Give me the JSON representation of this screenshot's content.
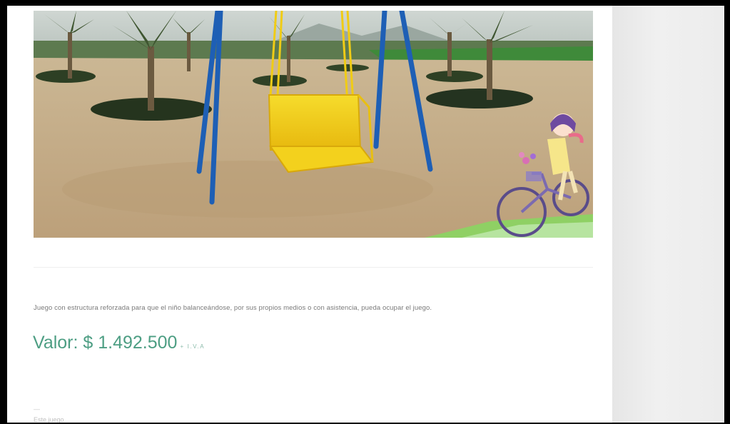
{
  "product": {
    "image_alt": "Columpio con asiento amarillo",
    "description": "Juego con estructura reforzada para que el niño balanceándose, por sus propios medios o con asistencia, pueda ocupar el juego.",
    "price_label": "Valor: $ 1.492.500",
    "price_suffix": "+ I.V.A",
    "separator": "—",
    "footer_text": "Este juego"
  },
  "colors": {
    "price": "#4d9e83",
    "swing_frame": "#1e5fb5",
    "swing_seat": "#f2d21c"
  }
}
